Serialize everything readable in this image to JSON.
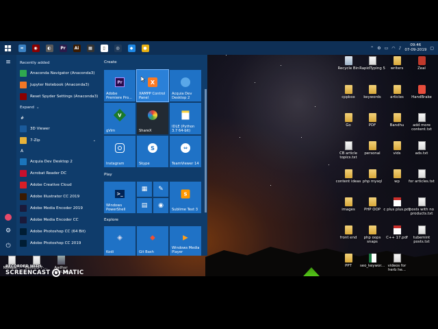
{
  "taskbar": {
    "pinned": [
      {
        "name": "python-icon",
        "glyph": "≈",
        "color": "#3b82c4"
      },
      {
        "name": "spyder-icon",
        "glyph": "◉",
        "color": "#8b0000"
      },
      {
        "name": "app-icon",
        "glyph": "◐",
        "color": "#5a5a5a"
      },
      {
        "name": "premiere-pro-icon",
        "glyph": "Pr",
        "color": "#2a1a4a"
      },
      {
        "name": "illustrator-icon",
        "glyph": "Ai",
        "color": "#3a1a00"
      },
      {
        "name": "calculator-icon",
        "glyph": "▦",
        "color": "#333333"
      },
      {
        "name": "document-icon",
        "glyph": "▯",
        "color": "#ffffff"
      },
      {
        "name": "record-icon",
        "glyph": "◎",
        "color": "#1f3a5a"
      },
      {
        "name": "vscode-icon",
        "glyph": "◆",
        "color": "#1e88e5"
      },
      {
        "name": "chrome-icon",
        "glyph": "●",
        "color": "#e8b012"
      }
    ],
    "time": "09:46",
    "date": "07-09-2019"
  },
  "start_menu": {
    "recently_added_label": "Recently added",
    "recent": [
      {
        "label": "Anaconda Navigator (Anaconda3)",
        "icon": "anaconda-icon",
        "color": "#2fa84f"
      },
      {
        "label": "Jupyter Notebook (Anaconda3)",
        "icon": "jupyter-icon",
        "color": "#f37726"
      },
      {
        "label": "Reset Spyder Settings (Anaconda3)",
        "icon": "spyder-icon",
        "color": "#8b0000"
      }
    ],
    "expand_label": "Expand",
    "hash_letter": "#",
    "hash_apps": [
      {
        "label": "3D Viewer",
        "icon": "cube-icon",
        "color": "#1a5a9a",
        "chev": ""
      },
      {
        "label": "7-Zip",
        "icon": "folder-icon",
        "color": "#e8b339",
        "chev": "⌄"
      }
    ],
    "a_letter": "A",
    "a_apps": [
      {
        "label": "Acquia Dev Desktop 2",
        "icon": "acquia-icon",
        "color": "#1b75bc",
        "chev": ""
      },
      {
        "label": "Acrobat Reader DC",
        "icon": "acrobat-icon",
        "color": "#c8102e",
        "chev": ""
      },
      {
        "label": "Adobe Creative Cloud",
        "icon": "creative-cloud-icon",
        "color": "#da1f26",
        "chev": ""
      },
      {
        "label": "Adobe Illustrator CC 2019",
        "icon": "illustrator-icon",
        "color": "#3a1a00",
        "chev": ""
      },
      {
        "label": "Adobe Media Encoder 2019",
        "icon": "media-encoder-icon",
        "color": "#1a1a3a",
        "chev": ""
      },
      {
        "label": "Adobe Media Encoder CC",
        "icon": "media-encoder-icon",
        "color": "#1a1a3a",
        "chev": ""
      },
      {
        "label": "Adobe Photoshop CC (64 Bit)",
        "icon": "photoshop-icon",
        "color": "#001d34",
        "chev": ""
      },
      {
        "label": "Adobe Photoshop CC 2019",
        "icon": "photoshop-icon",
        "color": "#001d34",
        "chev": ""
      }
    ],
    "groups": {
      "create": "Create",
      "play": "Play",
      "explore": "Explore"
    },
    "tiles": {
      "premiere": "Adobe Premiere Pro...",
      "xampp": "XAMPP Control Panel",
      "acquia": "Acquia Dev Desktop 2",
      "gvim": "gVim",
      "sharex": "ShareX",
      "idle": "IDLE (Python 3.7 64-bit)",
      "instagram": "Instagram",
      "skype": "Skype",
      "teamviewer": "TeamViewer 14",
      "powershell": "Windows PowerShell",
      "sublime": "Sublime Text 3",
      "kodi": "Kodi",
      "gitbash": "Git Bash",
      "wmp": "Windows Media Player"
    }
  },
  "desktop": {
    "icons": [
      {
        "label": "Recycle Bin",
        "kind": "bin"
      },
      {
        "label": "RapidTyping 5",
        "kind": "doc"
      },
      {
        "label": "writers",
        "kind": "fold"
      },
      {
        "label": "Zeal",
        "kind": "zeal"
      },
      {
        "label": "cppbox",
        "kind": "fold"
      },
      {
        "label": "keywords",
        "kind": "fold"
      },
      {
        "label": "articles",
        "kind": "fold"
      },
      {
        "label": "HandBrake",
        "kind": "hb"
      },
      {
        "label": "Go",
        "kind": "fold"
      },
      {
        "label": "PDF",
        "kind": "fold"
      },
      {
        "label": "Bandhu",
        "kind": "fold"
      },
      {
        "label": "add more content.txt",
        "kind": "doc"
      },
      {
        "label": "CB article topics.txt",
        "kind": "doc"
      },
      {
        "label": "personal",
        "kind": "fold"
      },
      {
        "label": "vids",
        "kind": "fold"
      },
      {
        "label": "ads.txt",
        "kind": "doc"
      },
      {
        "label": "content ideas",
        "kind": "fold"
      },
      {
        "label": "php mysql",
        "kind": "fold"
      },
      {
        "label": "wp",
        "kind": "fold"
      },
      {
        "label": "for articles.txt",
        "kind": "doc"
      },
      {
        "label": "images",
        "kind": "fold"
      },
      {
        "label": "PHP OOP",
        "kind": "fold"
      },
      {
        "label": "c plus plus.pdf",
        "kind": "pdf"
      },
      {
        "label": "posts with no products.txt",
        "kind": "doc"
      },
      {
        "label": "front end",
        "kind": "fold"
      },
      {
        "label": "php oops snaps",
        "kind": "fold"
      },
      {
        "label": "C++ 17.pdf",
        "kind": "pdf"
      },
      {
        "label": "tubemint posts.txt",
        "kind": "doc"
      },
      {
        "label": "PPT",
        "kind": "fold"
      },
      {
        "label": "seo_keywor...",
        "kind": "xls"
      },
      {
        "label": "videos for herb he...",
        "kind": "doc"
      }
    ],
    "bottom_icons": [
      {
        "label": "Notepa...",
        "kind": "doc"
      },
      {
        "label": "CentOS-7-...",
        "kind": "doc"
      },
      {
        "label": "Aadhar front.jpg",
        "kind": "img"
      }
    ]
  },
  "watermark": {
    "recorded_with": "RECORDED WITH",
    "screen": "SCREENCAST",
    "matic": "MATIC"
  }
}
